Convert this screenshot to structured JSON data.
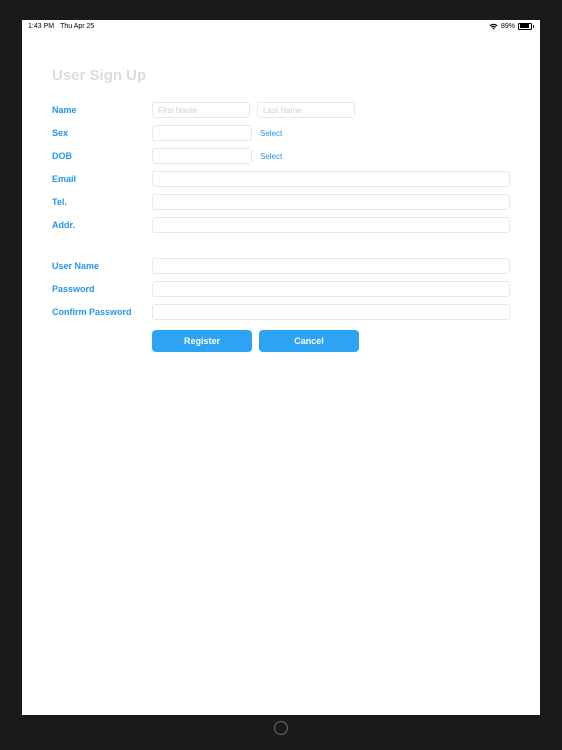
{
  "status": {
    "time": "1:43 PM",
    "date": "Thu Apr 25",
    "battery_pct": "89%"
  },
  "page": {
    "title": "User Sign Up"
  },
  "labels": {
    "name": "Name",
    "sex": "Sex",
    "dob": "DOB",
    "email": "Email",
    "tel": "Tel.",
    "addr": "Addr.",
    "username": "User Name",
    "password": "Password",
    "confirm_password": "Confirm Password"
  },
  "placeholders": {
    "first_name": "First Name",
    "last_name": "Last Name"
  },
  "links": {
    "select_sex": "Select",
    "select_dob": "Select"
  },
  "buttons": {
    "register": "Register",
    "cancel": "Cancel"
  }
}
